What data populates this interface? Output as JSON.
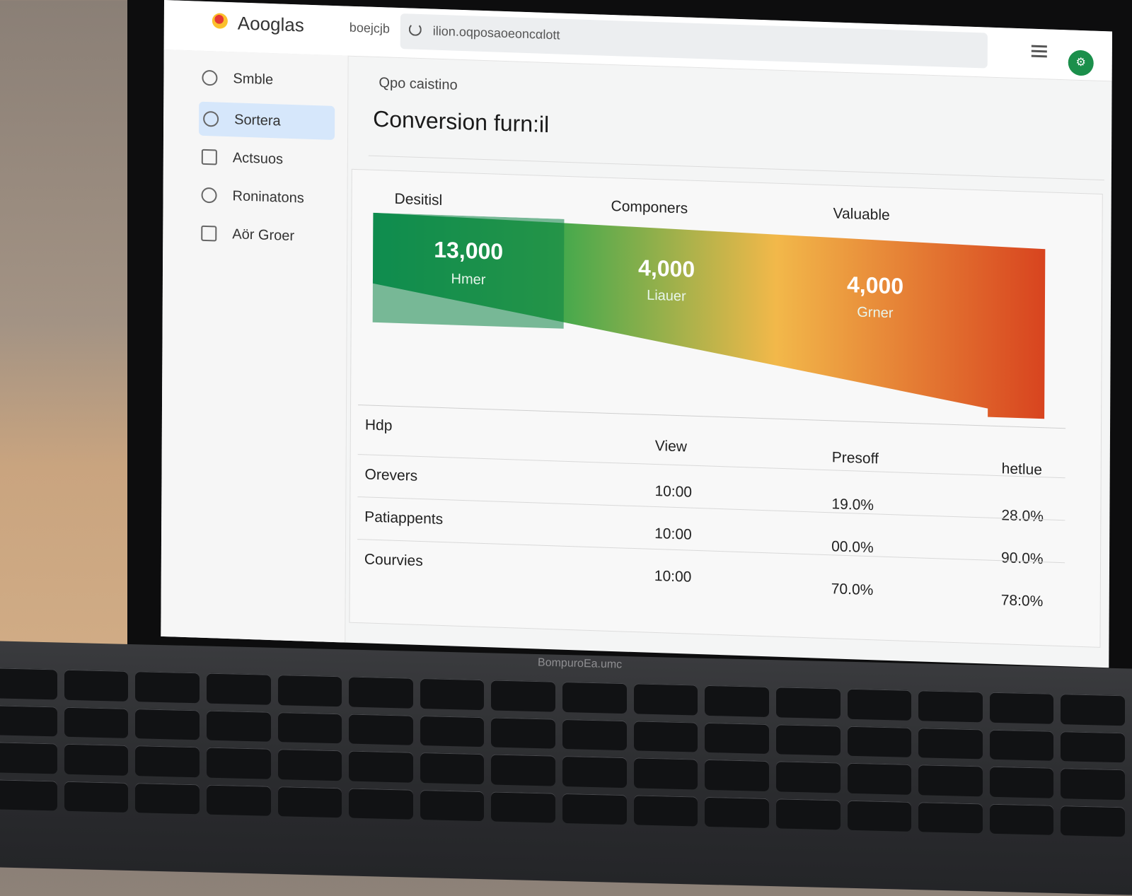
{
  "header": {
    "app_name": "Aooglas",
    "crumb": "boejcjb",
    "search_value": "ilion.oqposaoeoncαlott",
    "avatar_glyph": "⚙"
  },
  "sidebar": {
    "items": [
      {
        "label": "Smble",
        "icon": "info-circle-icon"
      },
      {
        "label": "Sortera",
        "icon": "shield-icon",
        "active": true
      },
      {
        "label": "Actsuos",
        "icon": "document-icon"
      },
      {
        "label": "Roninatons",
        "icon": "chat-icon"
      },
      {
        "label": "Aör Groer",
        "icon": "lock-icon"
      }
    ]
  },
  "main": {
    "section": "Qpo caistino",
    "title": "Conversion furn:il"
  },
  "chart_data": {
    "type": "funnel",
    "stage_labels": [
      "Desitisl",
      "Componers",
      "Valuable"
    ],
    "stages": [
      {
        "value": "13,000",
        "sublabel": "Hmer"
      },
      {
        "value": "4,000",
        "sublabel": "Liauer"
      },
      {
        "value": "4,000",
        "sublabel": "Grner"
      }
    ],
    "colors": {
      "start": "#12985a",
      "mid": "#f2b84a",
      "end": "#d8441f"
    }
  },
  "table": {
    "headers": [
      "Hdp",
      "View",
      "Presoff",
      "hetlue"
    ],
    "rows": [
      [
        "Orevers",
        "10:00",
        "19.0%",
        "28.0%"
      ],
      [
        "Patiappents",
        "10:00",
        "00.0%",
        "90.0%"
      ],
      [
        "Courvies",
        "10:00",
        "70.0%",
        "78:0%"
      ]
    ]
  },
  "laptop": {
    "brand": "BompuroEa.umc"
  }
}
